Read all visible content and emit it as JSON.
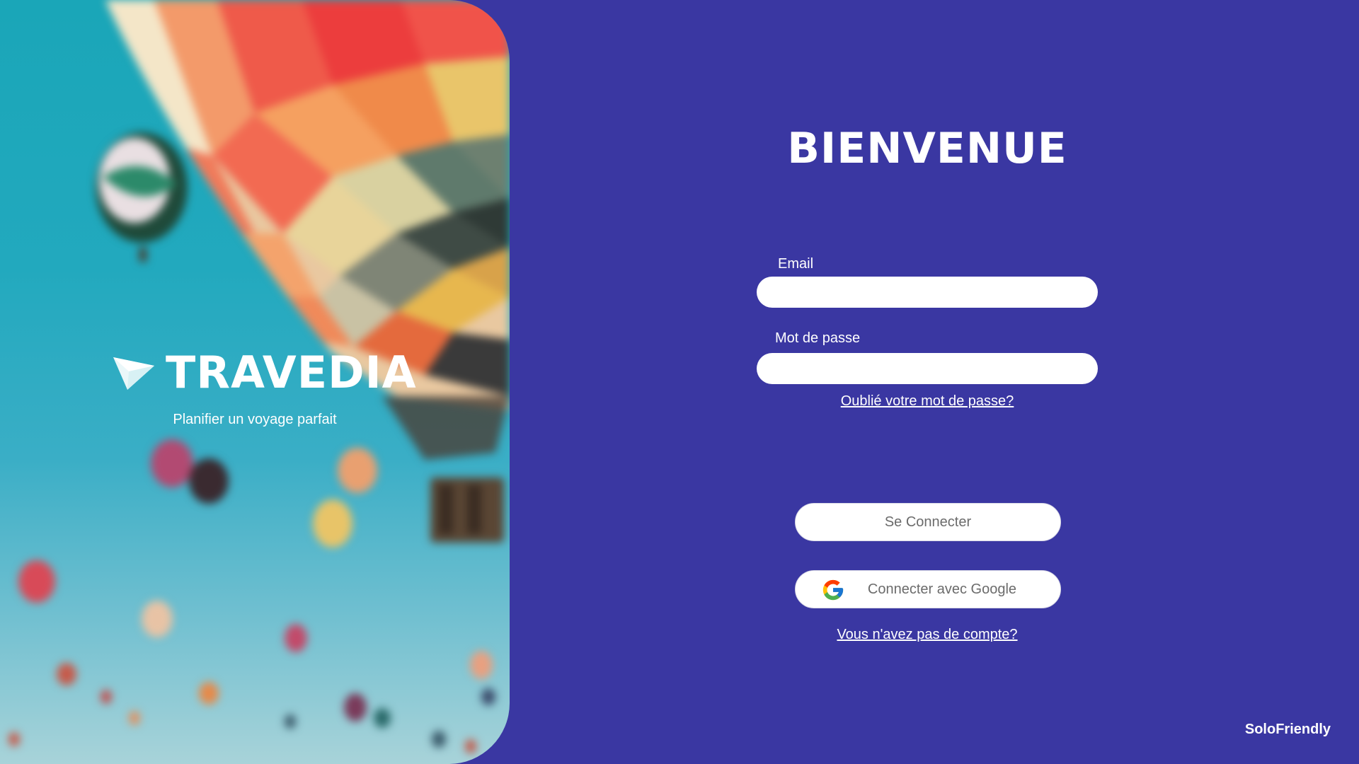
{
  "hero": {
    "brand_name": "TRAVEDIA",
    "tagline": "Planifier un voyage parfait",
    "logo_icon": "paper-plane-icon"
  },
  "login": {
    "title": "BIENVENUE",
    "email_label": "Email",
    "email_value": "",
    "password_label": "Mot de passe",
    "password_value": "",
    "forgot_link": "Oublié votre mot de passe?",
    "signin_button": "Se Connecter",
    "google_button": "Connecter avec Google",
    "google_icon": "google-icon",
    "signup_link": "Vous n'avez pas de compte?"
  },
  "footer": {
    "brand": "SoloFriendly"
  },
  "colors": {
    "background": "#3a37a2",
    "input_bg": "#ffffff",
    "text": "#ffffff"
  }
}
